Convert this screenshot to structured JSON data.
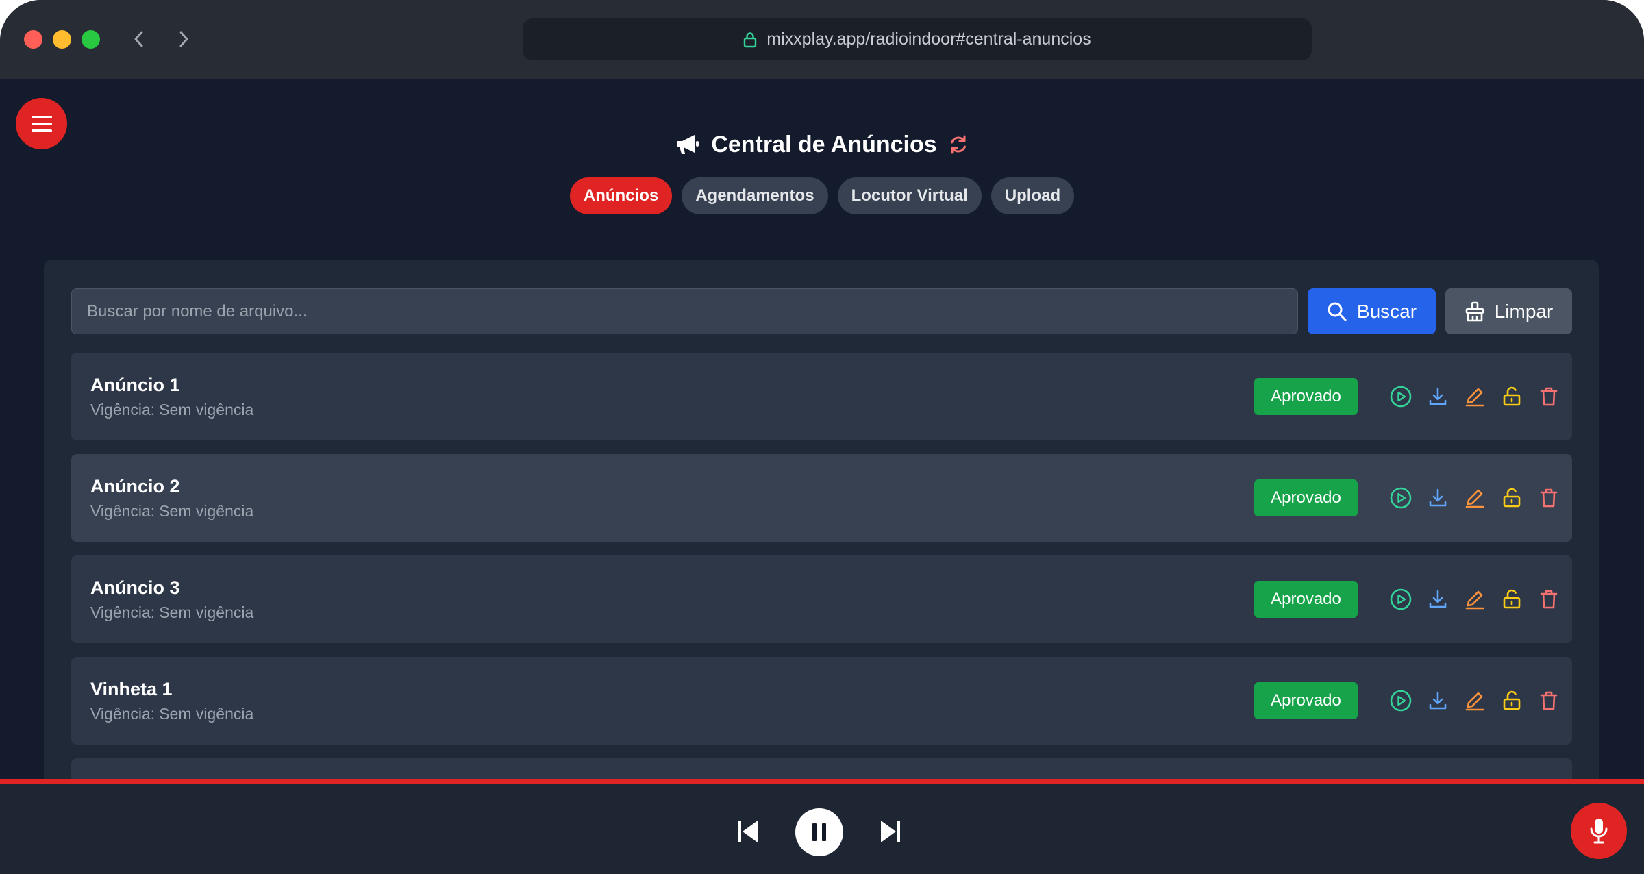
{
  "browser": {
    "url": "mixxplay.app/radioindoor#central-anuncios"
  },
  "header": {
    "title": "Central de Anúncios"
  },
  "tabs": [
    {
      "label": "Anúncios",
      "active": true
    },
    {
      "label": "Agendamentos",
      "active": false
    },
    {
      "label": "Locutor Virtual",
      "active": false
    },
    {
      "label": "Upload",
      "active": false
    }
  ],
  "search": {
    "placeholder": "Buscar por nome de arquivo...",
    "value": "",
    "search_label": "Buscar",
    "clear_label": "Limpar"
  },
  "items": [
    {
      "name": "Anúncio 1",
      "validity_label": "Vigência:",
      "validity_value": "Sem vigência",
      "status": "Aprovado"
    },
    {
      "name": "Anúncio 2",
      "validity_label": "Vigência:",
      "validity_value": "Sem vigência",
      "status": "Aprovado"
    },
    {
      "name": "Anúncio 3",
      "validity_label": "Vigência:",
      "validity_value": "Sem vigência",
      "status": "Aprovado"
    },
    {
      "name": "Vinheta 1",
      "validity_label": "Vigência:",
      "validity_value": "Sem vigência",
      "status": "Aprovado"
    }
  ],
  "colors": {
    "accent": "#e02424",
    "primary": "#2563eb",
    "approved": "#16a34a",
    "play": "#34d399",
    "download": "#60a5fa",
    "edit": "#fb923c",
    "unlock": "#facc15",
    "delete": "#f87171"
  },
  "icons": {
    "menu": "menu-icon",
    "title": "megaphone-icon",
    "refresh": "refresh-icon",
    "lock": "lock-icon",
    "row_actions": [
      "play-icon",
      "download-icon",
      "edit-icon",
      "unlock-icon",
      "trash-icon"
    ],
    "player": [
      "skip-previous-icon",
      "pause-icon",
      "skip-next-icon",
      "microphone-icon"
    ]
  }
}
